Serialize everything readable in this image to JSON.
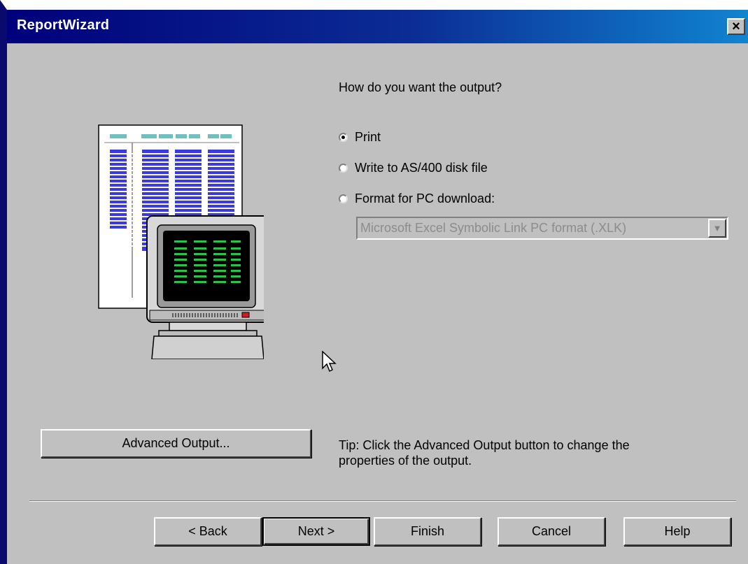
{
  "window": {
    "title": "ReportWizard",
    "close_glyph": "✕"
  },
  "question": "How do you want the output?",
  "output_options": [
    {
      "label": "Print",
      "selected": true
    },
    {
      "label": "Write to AS/400 disk file",
      "selected": false
    },
    {
      "label": "Format for PC download:",
      "selected": false
    }
  ],
  "pc_format_select": {
    "value": "Microsoft Excel Symbolic Link PC format (.XLK)",
    "disabled": true
  },
  "advanced_output_button": "Advanced Output...",
  "tip": {
    "line1": "Tip:  Click the Advanced Output button to change the",
    "line2": "properties of the output."
  },
  "nav_buttons": {
    "back": "< Back",
    "next": "Next >",
    "finish": "Finish",
    "cancel": "Cancel",
    "help": "Help"
  },
  "illustration": {
    "icon": "report-computer-illustration"
  }
}
